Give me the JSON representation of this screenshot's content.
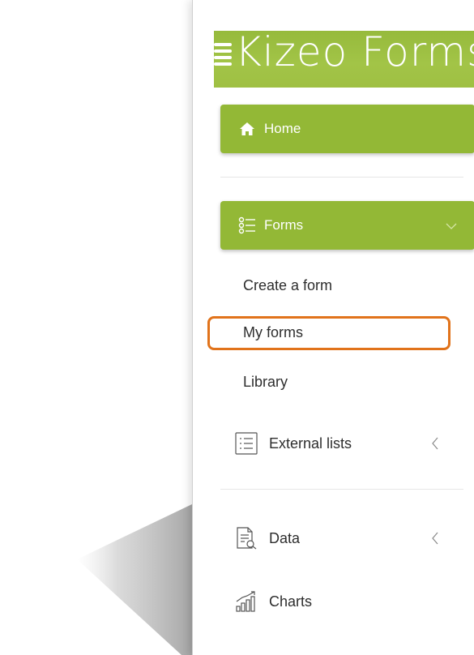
{
  "brand": {
    "logo_text": "Kizeo Forms",
    "accent_color": "#93b836",
    "highlight_color": "#e1731b"
  },
  "nav": {
    "home": {
      "label": "Home",
      "icon": "home-icon"
    },
    "forms": {
      "label": "Forms",
      "icon": "checklist-icon",
      "expanded": true,
      "items": [
        {
          "label": "Create a form"
        },
        {
          "label": "My forms",
          "highlighted": true
        },
        {
          "label": "Library"
        }
      ]
    },
    "external_lists": {
      "label": "External lists",
      "icon": "list-icon",
      "collapsed_indicator": "chevron-left-icon"
    },
    "data": {
      "label": "Data",
      "icon": "document-search-icon",
      "collapsed_indicator": "chevron-left-icon"
    },
    "charts": {
      "label": "Charts",
      "icon": "bar-chart-icon"
    }
  }
}
